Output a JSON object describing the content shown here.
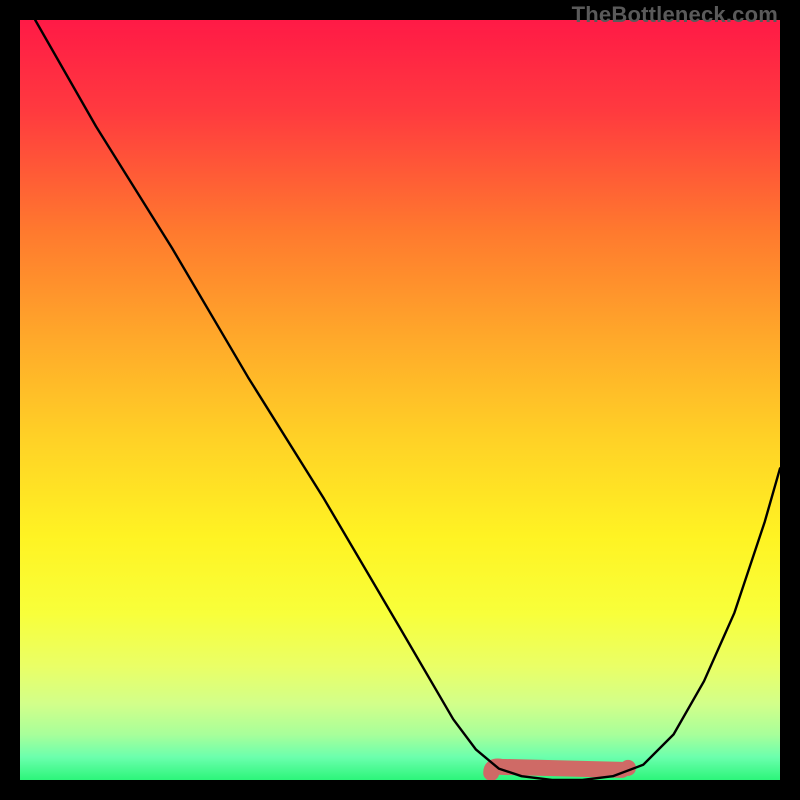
{
  "watermark": "TheBottleneck.com",
  "chart_data": {
    "type": "line",
    "title": "",
    "xlabel": "",
    "ylabel": "",
    "xlim": [
      0,
      100
    ],
    "ylim": [
      0,
      100
    ],
    "series": [
      {
        "name": "bottleneck-curve",
        "x": [
          2,
          10,
          20,
          30,
          40,
          50,
          57,
          60,
          63,
          66,
          70,
          74,
          78,
          82,
          86,
          90,
          94,
          98,
          100
        ],
        "y": [
          100,
          86,
          70,
          53,
          37,
          20,
          8,
          4,
          1.5,
          0.5,
          0,
          0,
          0.5,
          2,
          6,
          13,
          22,
          34,
          41
        ],
        "color": "#000000"
      }
    ],
    "highlight_band": {
      "name": "optimal-range",
      "x_start": 62,
      "x_end": 80,
      "y": 1.2,
      "color": "#cf6a66"
    },
    "gradient_stops": [
      {
        "offset": 0.0,
        "color": "#ff1a46"
      },
      {
        "offset": 0.12,
        "color": "#ff3a3f"
      },
      {
        "offset": 0.28,
        "color": "#ff7a2e"
      },
      {
        "offset": 0.42,
        "color": "#ffa92a"
      },
      {
        "offset": 0.55,
        "color": "#ffd126"
      },
      {
        "offset": 0.68,
        "color": "#fff323"
      },
      {
        "offset": 0.78,
        "color": "#f8ff3a"
      },
      {
        "offset": 0.85,
        "color": "#eaff66"
      },
      {
        "offset": 0.9,
        "color": "#d2ff8a"
      },
      {
        "offset": 0.94,
        "color": "#a8ff9a"
      },
      {
        "offset": 0.97,
        "color": "#6bffad"
      },
      {
        "offset": 1.0,
        "color": "#2cf57a"
      }
    ]
  }
}
